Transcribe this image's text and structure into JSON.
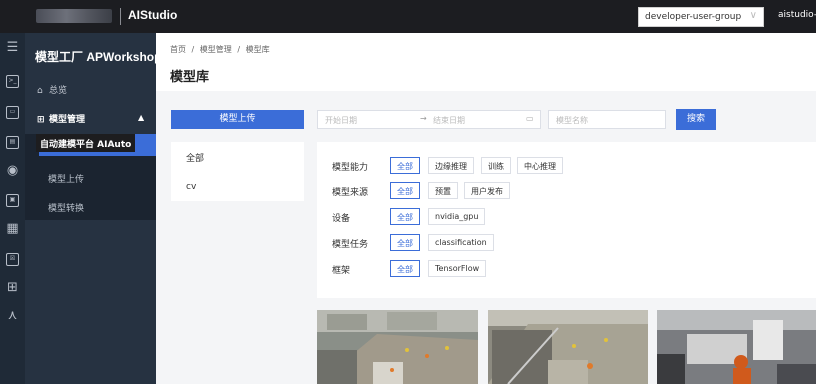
{
  "topbar": {
    "app_title": "AIStudio",
    "group_select": "developer-user-group",
    "group_chevron": "∨",
    "user": "aistudio-test"
  },
  "iconbar": {
    "icons": [
      "list-icon",
      "terminal-icon",
      "image-icon",
      "server-icon",
      "screen-icon",
      "eye-icon",
      "model-icon",
      "building-icon",
      "box-icon",
      "grid-icon",
      "network-icon"
    ]
  },
  "sidebar": {
    "title": "模型工厂 APWorkshop",
    "overview": "总览",
    "model_mgmt": "模型管理",
    "tooltip": "自动建模平台 AIAuto",
    "sub_items": [
      "模型上传",
      "模型转换"
    ]
  },
  "breadcrumb": [
    "首页",
    "/",
    "模型管理",
    "/",
    "模型库"
  ],
  "page_title": "模型库",
  "toolbar": {
    "upload_label": "模型上传",
    "start_date": "开始日期",
    "arrow": "→",
    "end_date": "结束日期",
    "model_name_placeholder": "模型名称",
    "search_label": "搜索"
  },
  "categories": [
    "全部",
    "cv"
  ],
  "filters": [
    {
      "label": "模型能力",
      "options": [
        "全部",
        "边缘推理",
        "训练",
        "中心推理"
      ]
    },
    {
      "label": "模型来源",
      "options": [
        "全部",
        "预置",
        "用户发布"
      ]
    },
    {
      "label": "设备",
      "options": [
        "全部",
        "nvidia_gpu"
      ]
    },
    {
      "label": "模型任务",
      "options": [
        "全部",
        "classification"
      ]
    },
    {
      "label": "框架",
      "options": [
        "全部",
        "TensorFlow"
      ]
    }
  ],
  "colors": {
    "accent": "#3b6dd8",
    "topbar": "#1c1d21",
    "sidebar": "#263241"
  }
}
